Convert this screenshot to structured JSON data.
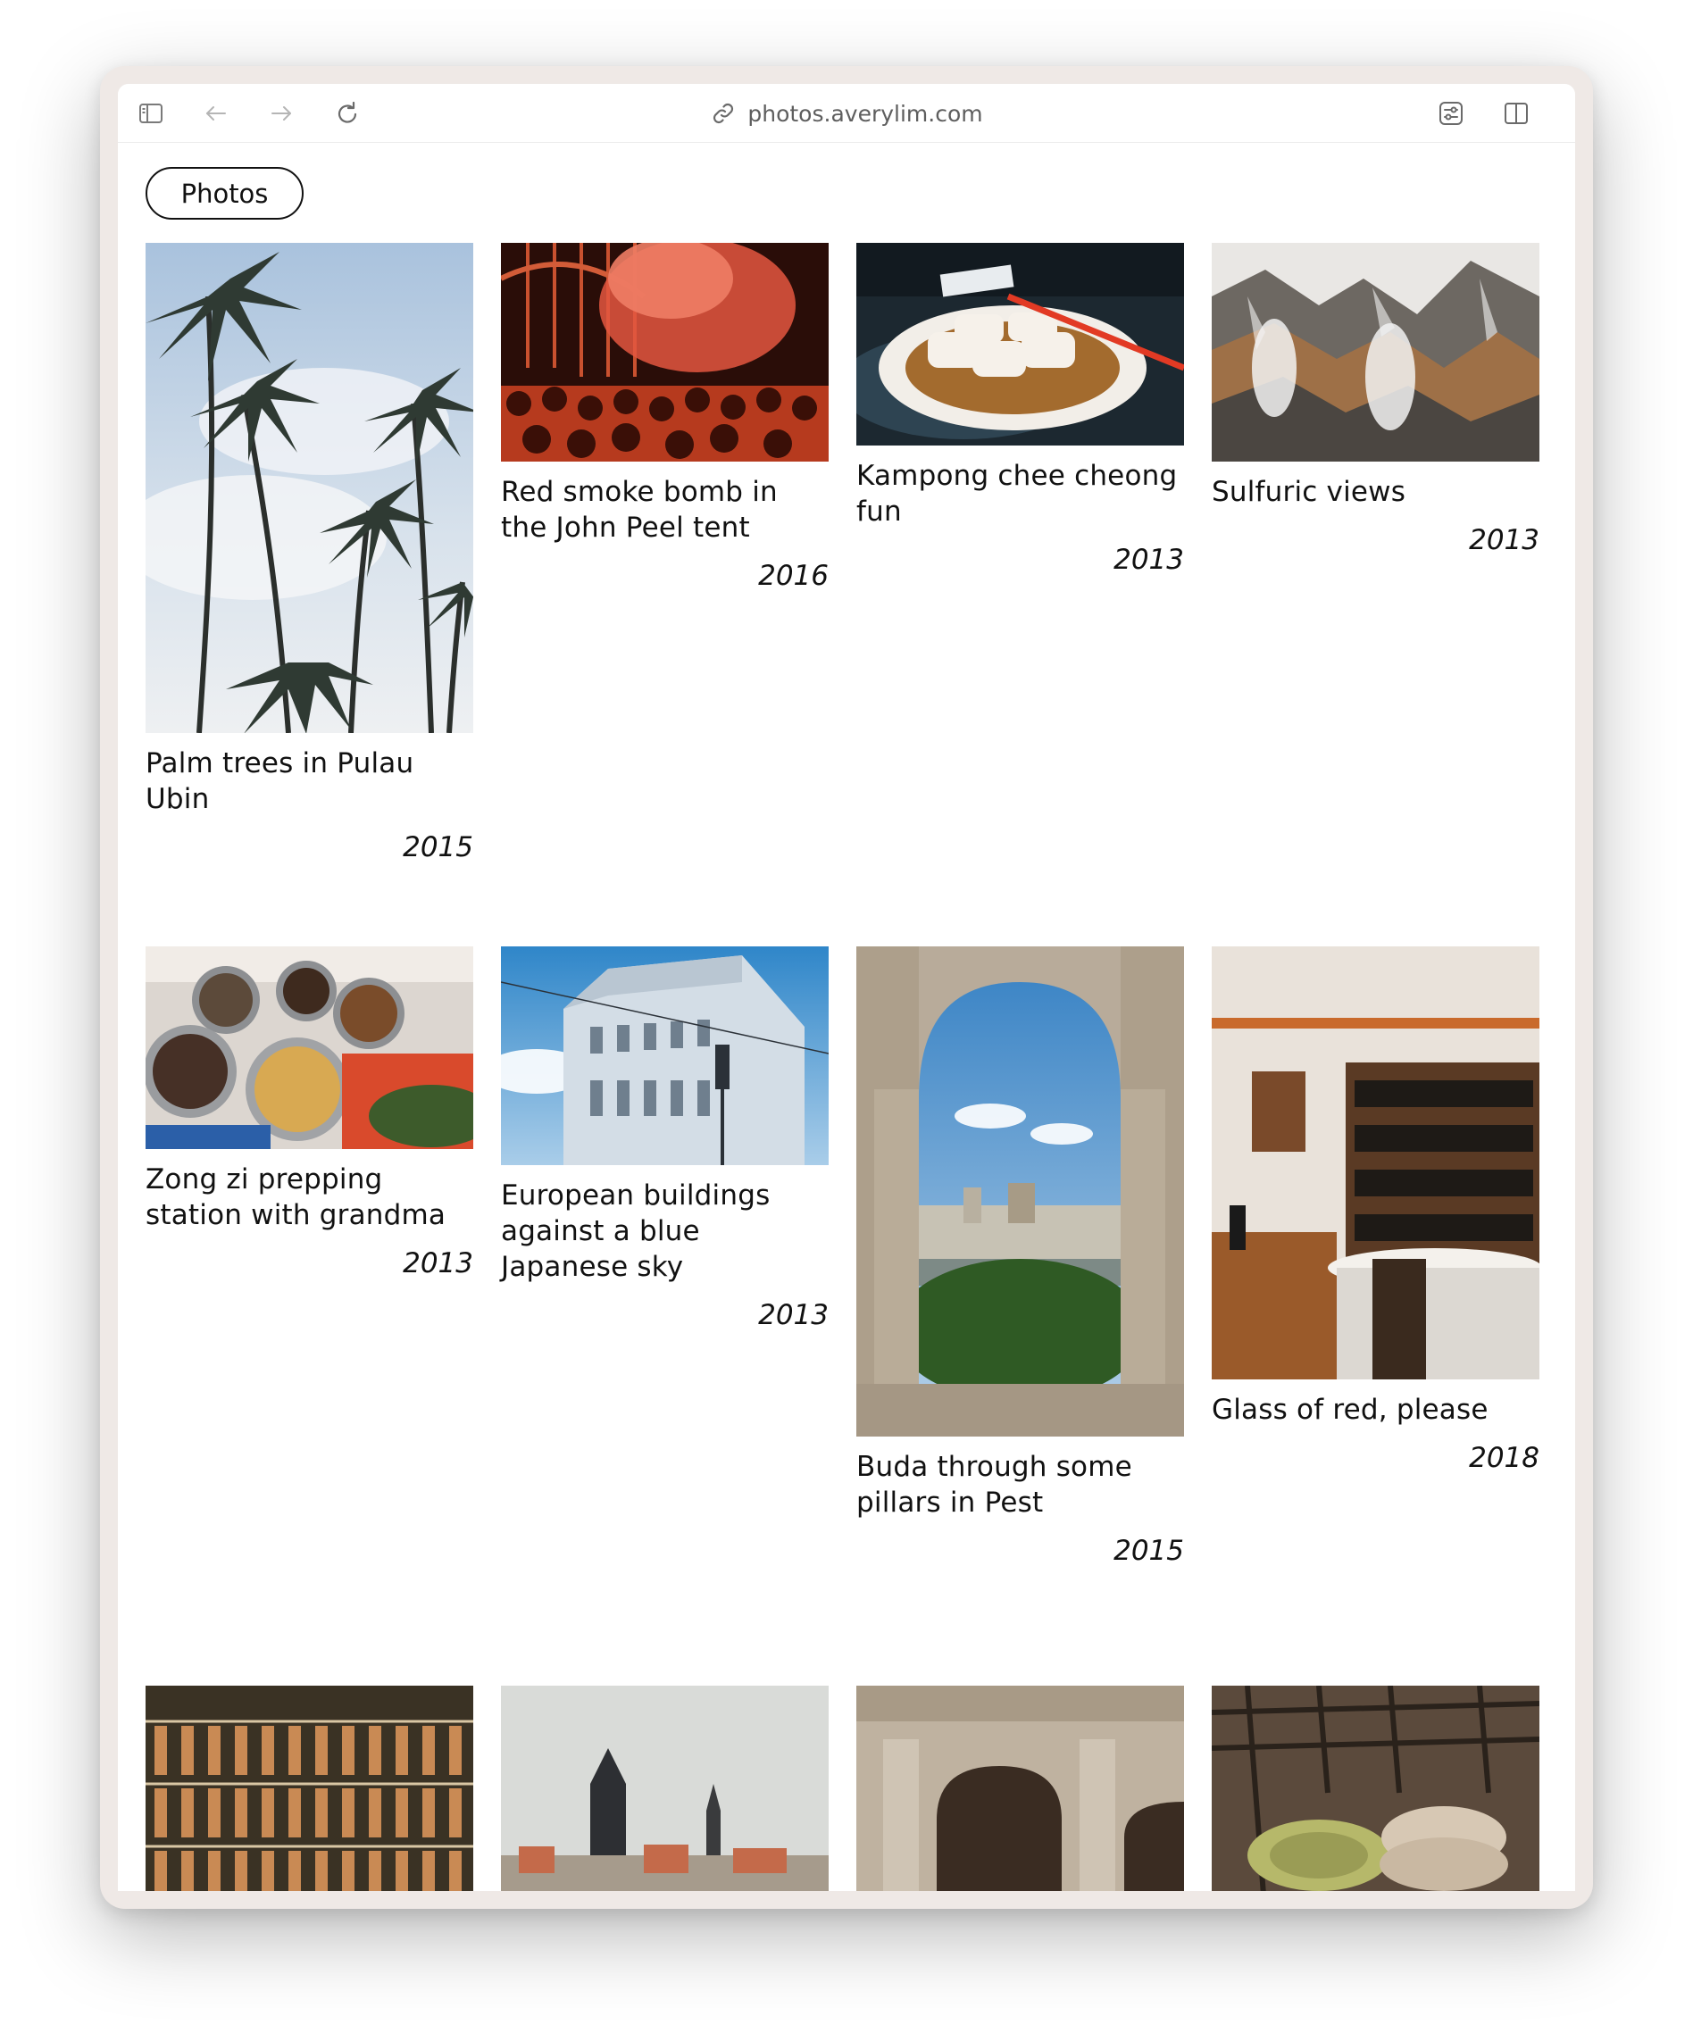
{
  "browser": {
    "url": "photos.averylim.com",
    "icons": [
      "sidebar-icon",
      "back-arrow-icon",
      "forward-arrow-icon",
      "reload-icon",
      "link-icon",
      "extension-settings-icon",
      "split-view-icon"
    ]
  },
  "page": {
    "pill_label": "Photos"
  },
  "photos": [
    {
      "caption": "Palm trees in Pulau Ubin",
      "year": "2015"
    },
    {
      "caption": "Red smoke bomb in the John Peel tent",
      "year": "2016"
    },
    {
      "caption": "Kampong chee cheong fun",
      "year": "2013"
    },
    {
      "caption": "Sulfuric views",
      "year": "2013"
    },
    {
      "caption": "Zong zi prepping station with grandma",
      "year": "2013"
    },
    {
      "caption": "European buildings against a blue Japanese sky",
      "year": "2013"
    },
    {
      "caption": "Buda through some pillars in Pest",
      "year": "2015"
    },
    {
      "caption": "Glass of red, please",
      "year": "2018"
    },
    {
      "caption": "",
      "year": ""
    },
    {
      "caption": "",
      "year": ""
    },
    {
      "caption": "",
      "year": ""
    },
    {
      "caption": "",
      "year": ""
    }
  ]
}
